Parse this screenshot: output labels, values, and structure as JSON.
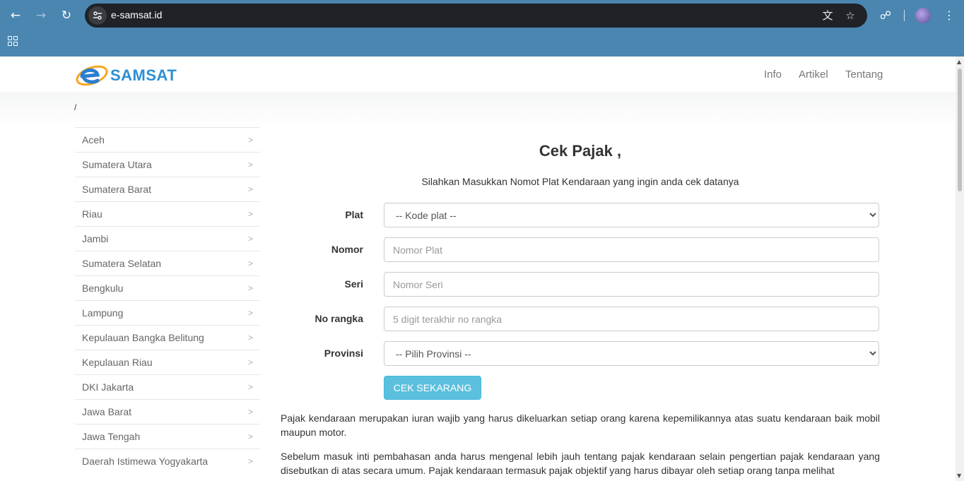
{
  "browser": {
    "url": "e-samsat.id",
    "icons": [
      "back-icon",
      "forward-icon",
      "reload-icon",
      "site-info-icon",
      "translate-icon",
      "bookmark-star-icon",
      "extensions-icon",
      "profile-avatar",
      "menu-icon",
      "apps-grid-icon"
    ]
  },
  "header": {
    "logo_text": "SAMSAT",
    "nav": [
      "Info",
      "Artikel",
      "Tentang"
    ]
  },
  "breadcrumb": "/",
  "sidebar": {
    "arrow": ">",
    "items": [
      "Aceh",
      "Sumatera Utara",
      "Sumatera Barat",
      "Riau",
      "Jambi",
      "Sumatera Selatan",
      "Bengkulu",
      "Lampung",
      "Kepulauan Bangka Belitung",
      "Kepulauan Riau",
      "DKI Jakarta",
      "Jawa Barat",
      "Jawa Tengah",
      "Daerah Istimewa Yogyakarta"
    ]
  },
  "main": {
    "title": "Cek Pajak ,",
    "subtitle": "Silahkan Masukkan Nomot Plat Kendaraan yang ingin anda cek datanya",
    "form": {
      "plat_label": "Plat",
      "plat_selected": "-- Kode plat --",
      "nomor_label": "Nomor",
      "nomor_placeholder": "Nomor Plat",
      "seri_label": "Seri",
      "seri_placeholder": "Nomor Seri",
      "rangka_label": "No rangka",
      "rangka_placeholder": "5 digit terakhir no rangka",
      "provinsi_label": "Provinsi",
      "provinsi_selected": "-- Pilih Provinsi --",
      "submit_label": "CEK SEKARANG"
    },
    "paragraphs": [
      "Pajak kendaraan merupakan iuran wajib yang harus dikeluarkan setiap orang karena kepemilikannya atas suatu kendaraan baik mobil maupun motor.",
      "Sebelum masuk inti pembahasan anda harus mengenal lebih jauh tentang pajak kendaraan selain pengertian pajak kendaraan yang disebutkan di atas secara umum. Pajak kendaraan termasuk pajak objektif yang harus dibayar oleh setiap orang tanpa melihat"
    ]
  },
  "colors": {
    "chrome": "#4a86b0",
    "omnibox": "#1f2226",
    "button": "#5bc0de",
    "logo_blue": "#2c8fd6"
  }
}
